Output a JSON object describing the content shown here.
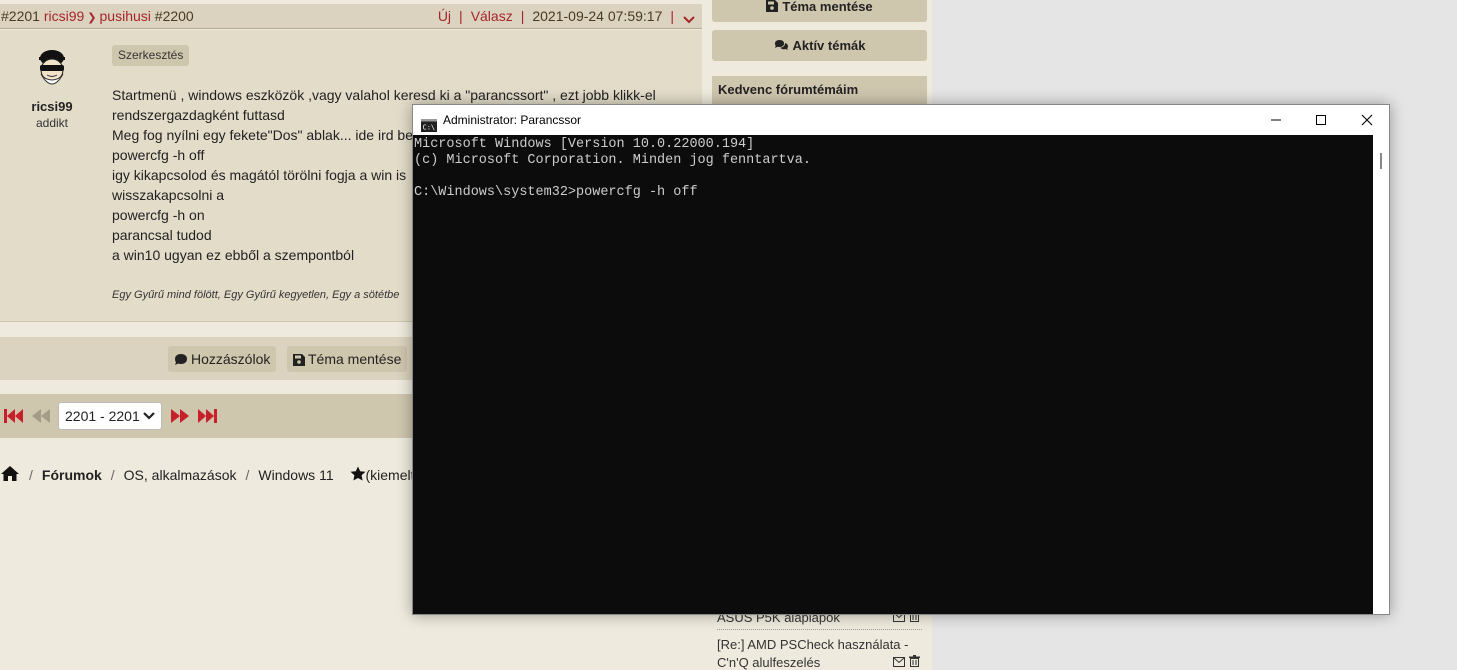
{
  "post": {
    "id": "#2201",
    "author": "ricsi99",
    "reply_to": "pusihusi",
    "reply_id": "#2200",
    "new_label": "Új",
    "reply_label": "Válasz",
    "datetime": "2021-09-24 07:59:17",
    "user_rank": "addikt",
    "edit_badge": "Szerkesztés",
    "lines": [
      "Startmenü , windows eszközök ,vagy valahol keresd ki a \"parancssort\" , ezt jobb klikk-el",
      "rendszergazdagként futtasd",
      "Meg fog nyílni egy fekete\"Dos\" ablak... ide ird be",
      "powercfg -h off",
      "igy kikapcsolod és magától törölni fogja a win is",
      "wisszakapcsolni a",
      "powercfg -h on",
      "parancsal tudod",
      "a win10 ugyan ez ebből a szempontból"
    ],
    "signature": "Egy Gyűrű mind fölött, Egy Gyűrű kegyetlen, Egy a sötétbe"
  },
  "actions": {
    "comments": "Hozzászólok",
    "save_topic": "Téma mentése"
  },
  "pager": {
    "range": "2201 - 2201"
  },
  "breadcrumb": {
    "forums": "Fórumok",
    "category": "OS, alkalmazások",
    "topic": "Windows 11",
    "featured": "(kiemelt"
  },
  "sidebar": {
    "save_topic": "Téma mentése",
    "active_topics": "Aktív témák",
    "favorites_title": "Kedvenc fórumtémáim",
    "fav_items": [
      "ASUS P5K alaplapok",
      "[Re:] AMD PSCheck használata -",
      "C'n'Q alulfeszelés"
    ]
  },
  "cmd": {
    "title": "Administrator: Parancssor",
    "lines": [
      "Microsoft Windows [Version 10.0.22000.194]",
      "(c) Microsoft Corporation. Minden jog fenntartva.",
      "",
      "C:\\Windows\\system32>powercfg -h off"
    ]
  },
  "colors": {
    "accent_red": "#a6262b",
    "panel": "#dbd3bf",
    "button": "#cfc6ae"
  }
}
